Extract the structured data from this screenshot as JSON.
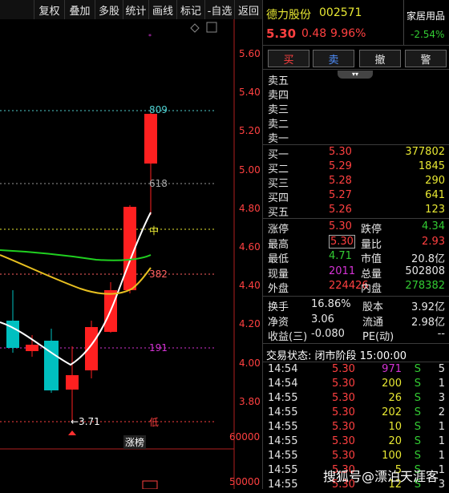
{
  "toolbar": [
    "复权",
    "叠加",
    "多股",
    "统计",
    "画线",
    "标记",
    "-自选",
    "返回"
  ],
  "stock": {
    "name": "德力股份",
    "code": "002571",
    "price": "5.30",
    "change": "0.48",
    "pct": "9.96%",
    "industry": "家居用品",
    "industry_pct": "-2.54%"
  },
  "trade_buttons": [
    "买",
    "卖",
    "撤",
    "警"
  ],
  "asks": [
    {
      "label": "卖五"
    },
    {
      "label": "卖四"
    },
    {
      "label": "卖三"
    },
    {
      "label": "卖二"
    },
    {
      "label": "卖一"
    }
  ],
  "bids": [
    {
      "label": "买一",
      "price": "5.30",
      "vol": "377802"
    },
    {
      "label": "买二",
      "price": "5.29",
      "vol": "1845"
    },
    {
      "label": "买三",
      "price": "5.28",
      "vol": "290"
    },
    {
      "label": "买四",
      "price": "5.27",
      "vol": "641"
    },
    {
      "label": "买五",
      "price": "5.26",
      "vol": "123"
    }
  ],
  "quote": [
    {
      "l1": "涨停",
      "v1": "5.30",
      "c1": "red",
      "l2": "跌停",
      "v2": "4.34",
      "c2": "green"
    },
    {
      "l1": "最高",
      "v1": "5.30",
      "c1": "red",
      "l2": "量比",
      "v2": "2.93",
      "c2": "red",
      "box": true
    },
    {
      "l1": "最低",
      "v1": "4.71",
      "c1": "green",
      "l2": "市值",
      "v2": "20.8亿",
      "c2": "white"
    },
    {
      "l1": "现量",
      "v1": "2011",
      "c1": "purple",
      "l2": "总量",
      "v2": "502808",
      "c2": "white"
    },
    {
      "l1": "外盘",
      "v1": "224426",
      "c1": "red",
      "l2": "内盘",
      "v2": "278382",
      "c2": "green"
    }
  ],
  "stats": [
    {
      "l1": "换手",
      "v1": "16.86%",
      "l2": "股本",
      "v2": "3.92亿"
    },
    {
      "l1": "净资",
      "v1": "3.06",
      "l2": "流通",
      "v2": "2.98亿"
    },
    {
      "l1": "收益(三)",
      "v1": "-0.080",
      "l2": "PE(动)",
      "v2": "--"
    }
  ],
  "status": "交易状态: 闭市阶段 15:00:00",
  "ticks": [
    {
      "t": "14:54",
      "p": "5.30",
      "v": "971",
      "s": "S",
      "n": "5",
      "vc": "purple"
    },
    {
      "t": "14:54",
      "p": "5.30",
      "v": "200",
      "s": "S",
      "n": "1",
      "vc": "yellow"
    },
    {
      "t": "14:55",
      "p": "5.30",
      "v": "26",
      "s": "S",
      "n": "3",
      "vc": "yellow"
    },
    {
      "t": "14:55",
      "p": "5.30",
      "v": "202",
      "s": "S",
      "n": "2",
      "vc": "yellow"
    },
    {
      "t": "14:55",
      "p": "5.30",
      "v": "10",
      "s": "S",
      "n": "1",
      "vc": "yellow"
    },
    {
      "t": "14:55",
      "p": "5.30",
      "v": "20",
      "s": "S",
      "n": "1",
      "vc": "yellow"
    },
    {
      "t": "14:55",
      "p": "5.30",
      "v": "100",
      "s": "S",
      "n": "1",
      "vc": "yellow"
    },
    {
      "t": "14:55",
      "p": "5.30",
      "v": "5",
      "s": "S",
      "n": "1",
      "vc": "yellow"
    },
    {
      "t": "14:55",
      "p": "5.30",
      "v": "12",
      "s": "S",
      "n": "3",
      "vc": "yellow"
    }
  ],
  "chart": {
    "y_ticks": [
      "5.60",
      "5.40",
      "5.20",
      "5.00",
      "4.80",
      "4.60",
      "4.40",
      "4.20",
      "4.00",
      "3.80"
    ],
    "vol_ticks": [
      "60000",
      "50000"
    ],
    "fib_labels": [
      "809",
      "618",
      "中",
      "382",
      "191",
      "低"
    ],
    "low_label": "←3.71",
    "limit_up_tag": "涨榜",
    "colors": {
      "up": "#ff2020",
      "down": "#00c0c0",
      "ma1": "#ffffff",
      "ma2": "#e8c020",
      "ma3": "#20d020"
    }
  },
  "watermark": "搜狐号@漂泊天涯客"
}
